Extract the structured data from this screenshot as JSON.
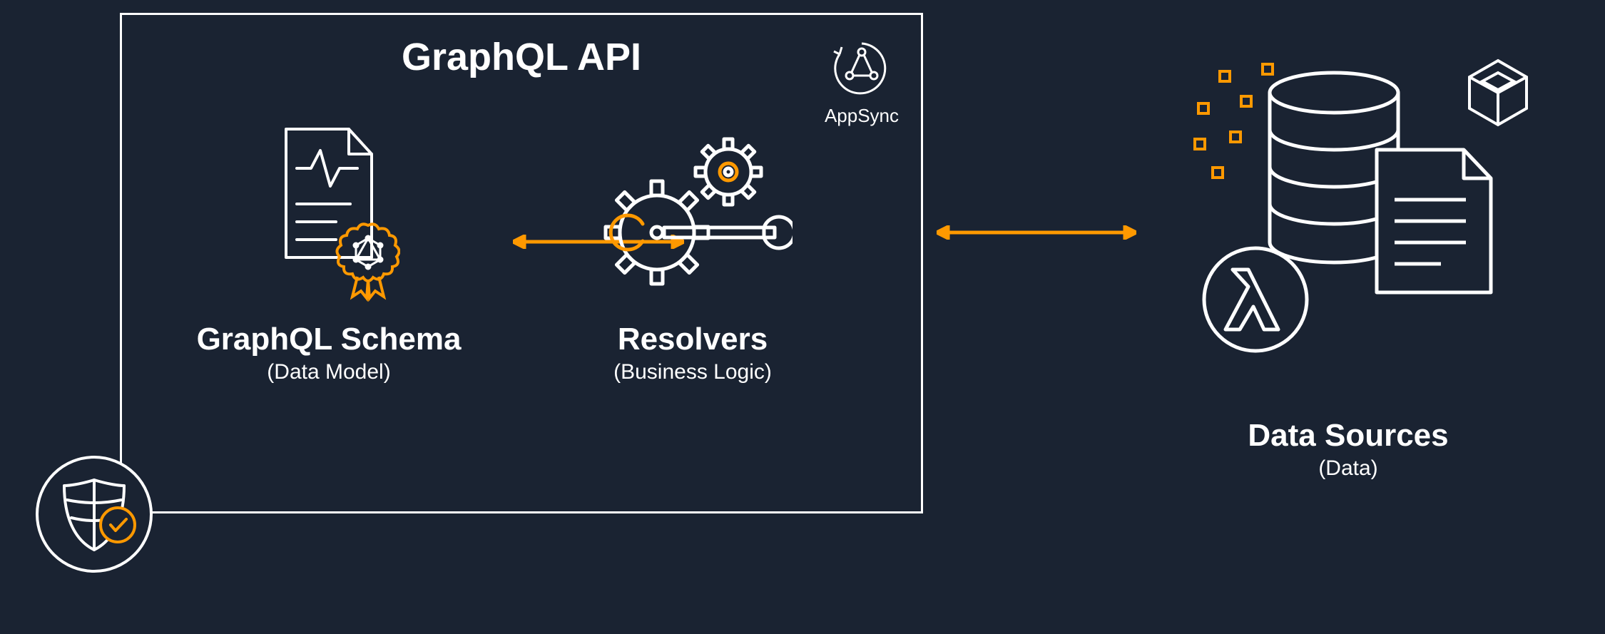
{
  "main": {
    "title": "GraphQL API",
    "appsync_label": "AppSync"
  },
  "schema": {
    "title": "GraphQL Schema",
    "subtitle": "(Data Model)"
  },
  "resolvers": {
    "title": "Resolvers",
    "subtitle": "(Business Logic)"
  },
  "datasources": {
    "title": "Data Sources",
    "subtitle": "(Data)"
  },
  "colors": {
    "bg": "#1a2332",
    "stroke": "#ffffff",
    "accent": "#ff9900"
  }
}
